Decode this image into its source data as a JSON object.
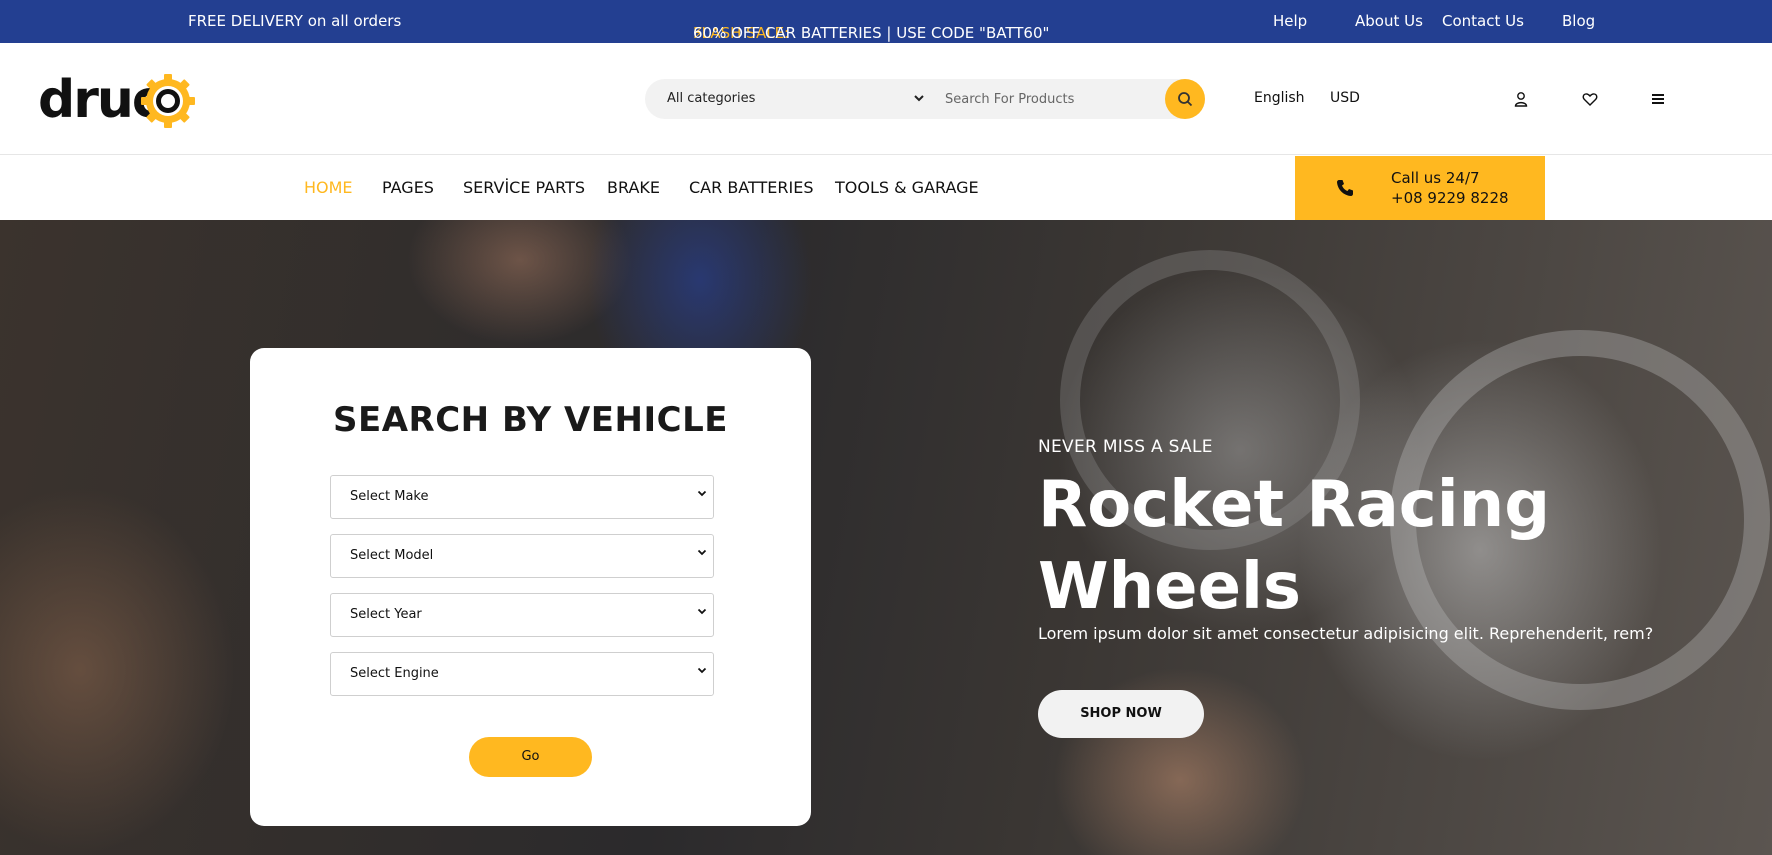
{
  "topbar": {
    "free_delivery": "FREE DELIVERY on all orders",
    "flash_icon": "lightning-icon",
    "flash_label": "FLASH SALE:",
    "flash_text": "60% OFF CAR BATTERIES | USE CODE \"BATT60\"",
    "links": [
      "Help",
      "About Us",
      "Contact Us",
      "Blog"
    ]
  },
  "header": {
    "logo_text": "druco",
    "search": {
      "category": "All categories",
      "placeholder": "Search For Products"
    },
    "language": "English",
    "currency": "USD",
    "icons": [
      "user-icon",
      "heart-icon",
      "menu-icon"
    ]
  },
  "nav": {
    "items": [
      "HOME",
      "PAGES",
      "SERVİCE PARTS",
      "BRAKE",
      "CAR BATTERIES",
      "TOOLS & GARAGE"
    ],
    "active": "HOME",
    "call_line1": "Call us 24/7",
    "call_line2": "+08 9229 8228"
  },
  "vehicle_search": {
    "title": "SEARCH BY VEHICLE",
    "selects": [
      "Select Make",
      "Select Model",
      "Select Year",
      "Select Engine"
    ],
    "go_label": "Go"
  },
  "hero": {
    "eyebrow": "NEVER MISS A SALE",
    "title_line1": "Rocket Racing",
    "title_line2": "Wheels",
    "subtitle": "Lorem ipsum dolor sit amet consectetur adipisicing elit. Reprehenderit, rem?",
    "cta": "SHOP NOW"
  },
  "colors": {
    "topbar_bg": "#233f91",
    "accent": "#ffb820"
  }
}
